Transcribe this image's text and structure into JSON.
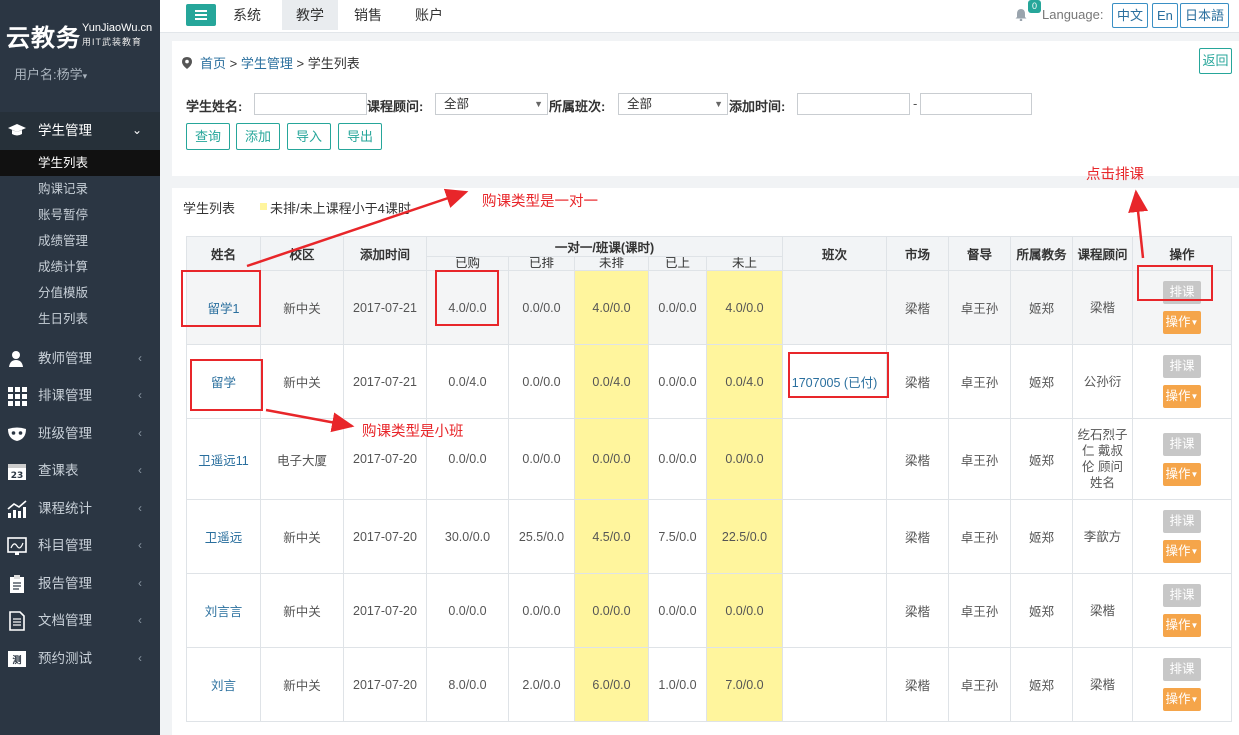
{
  "brand": {
    "main": "云教务",
    "en": "YunJiaoWu.cn",
    "cn": "用IT武装教育"
  },
  "user": {
    "label": "用户名:杨学"
  },
  "sidebar": {
    "items": [
      {
        "label": "学生管理",
        "icon": "graduation-cap-icon",
        "open": true
      },
      {
        "label": "教师管理",
        "icon": "teacher-icon"
      },
      {
        "label": "排课管理",
        "icon": "grid-icon"
      },
      {
        "label": "班级管理",
        "icon": "mask-icon"
      },
      {
        "label": "查课表",
        "icon": "calendar-icon"
      },
      {
        "label": "课程统计",
        "icon": "chart-icon"
      },
      {
        "label": "科目管理",
        "icon": "board-icon"
      },
      {
        "label": "报告管理",
        "icon": "clipboard-icon"
      },
      {
        "label": "文档管理",
        "icon": "document-icon"
      },
      {
        "label": "预约测试",
        "icon": "test-icon"
      }
    ],
    "sub_items": [
      "学生列表",
      "购课记录",
      "账号暂停",
      "成绩管理",
      "成绩计算",
      "分值模版",
      "生日列表"
    ]
  },
  "topbar": {
    "tabs": [
      "系统",
      "教学",
      "销售",
      "账户"
    ],
    "active_tab": "教学",
    "notification_count": "0",
    "language_label": "Language:",
    "languages": [
      "中文",
      "En",
      "日本語"
    ]
  },
  "breadcrumb": {
    "home": "首页",
    "sep": " > ",
    "parent": "学生管理",
    "current": "学生列表"
  },
  "back_label": "返回",
  "filters": {
    "student_name_label": "学生姓名:",
    "advisor_label": "课程顾问:",
    "advisor_value": "全部",
    "class_label": "所属班次:",
    "class_value": "全部",
    "time_label": "添加时间:",
    "range_sep": "-"
  },
  "actions": [
    "查询",
    "添加",
    "导入",
    "导出"
  ],
  "list": {
    "title": "学生列表",
    "legend": "未排/未上课程小于4课时",
    "legend_color": "#fff59d"
  },
  "table": {
    "headers": {
      "name": "姓名",
      "campus": "校区",
      "added": "添加时间",
      "group": "一对一/班课(课时)",
      "bought": "已购",
      "scheduled": "已排",
      "unscheduled": "未排",
      "attended": "已上",
      "unattended": "未上",
      "class": "班次",
      "market": "市场",
      "supervisor": "督导",
      "staff": "所属教务",
      "advisor": "课程顾问",
      "ops": "操作"
    },
    "sched_label": "排课",
    "op_label": "操作",
    "rows": [
      {
        "name": "留学1",
        "campus": "新中关",
        "added": "2017-07-21",
        "bought": "4.0/0.0",
        "scheduled": "0.0/0.0",
        "unscheduled": "4.0/0.0",
        "attended": "0.0/0.0",
        "unattended": "4.0/0.0",
        "class": "",
        "market": "梁楷",
        "supervisor": "卓王孙",
        "staff": "姬郑",
        "advisor": "梁楷"
      },
      {
        "name": "留学",
        "campus": "新中关",
        "added": "2017-07-21",
        "bought": "0.0/4.0",
        "scheduled": "0.0/0.0",
        "unscheduled": "0.0/4.0",
        "attended": "0.0/0.0",
        "unattended": "0.0/4.0",
        "class": "1707005 (已付)",
        "market": "梁楷",
        "supervisor": "卓王孙",
        "staff": "姬郑",
        "advisor": "公孙衍"
      },
      {
        "name": "卫遥远11",
        "campus": "电子大厦",
        "added": "2017-07-20",
        "bought": "0.0/0.0",
        "scheduled": "0.0/0.0",
        "unscheduled": "0.0/0.0",
        "attended": "0.0/0.0",
        "unattended": "0.0/0.0",
        "class": "",
        "market": "梁楷",
        "supervisor": "卓王孙",
        "staff": "姬郑",
        "advisor": "纥石烈子仁 戴叔伦 顾问姓名"
      },
      {
        "name": "卫遥远",
        "campus": "新中关",
        "added": "2017-07-20",
        "bought": "30.0/0.0",
        "scheduled": "25.5/0.0",
        "unscheduled": "4.5/0.0",
        "attended": "7.5/0.0",
        "unattended": "22.5/0.0",
        "class": "",
        "market": "梁楷",
        "supervisor": "卓王孙",
        "staff": "姬郑",
        "advisor": "李歆方"
      },
      {
        "name": "刘言言",
        "campus": "新中关",
        "added": "2017-07-20",
        "bought": "0.0/0.0",
        "scheduled": "0.0/0.0",
        "unscheduled": "0.0/0.0",
        "attended": "0.0/0.0",
        "unattended": "0.0/0.0",
        "class": "",
        "market": "梁楷",
        "supervisor": "卓王孙",
        "staff": "姬郑",
        "advisor": "梁楷"
      },
      {
        "name": "刘言",
        "campus": "新中关",
        "added": "2017-07-20",
        "bought": "8.0/0.0",
        "scheduled": "2.0/0.0",
        "unscheduled": "6.0/0.0",
        "attended": "1.0/0.0",
        "unattended": "7.0/0.0",
        "class": "",
        "market": "梁楷",
        "supervisor": "卓王孙",
        "staff": "姬郑",
        "advisor": "梁楷"
      }
    ]
  },
  "annotations": {
    "one_on_one": "购课类型是一对一",
    "small_class": "购课类型是小班",
    "click_schedule": "点击排课",
    "color": "#e8262a"
  }
}
